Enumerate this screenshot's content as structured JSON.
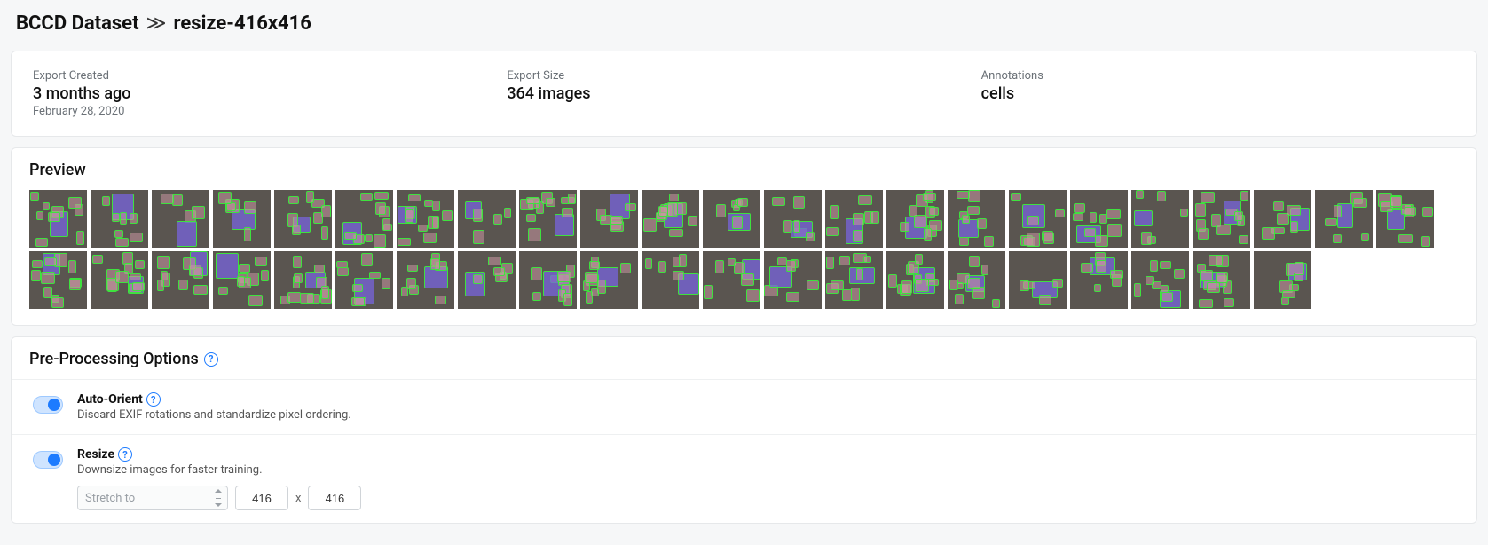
{
  "breadcrumb": {
    "dataset": "BCCD Dataset",
    "version": "resize-416x416"
  },
  "info": {
    "created_label": "Export Created",
    "created_value": "3 months ago",
    "created_date": "February 28, 2020",
    "size_label": "Export Size",
    "size_value": "364 images",
    "ann_label": "Annotations",
    "ann_value": "cells"
  },
  "preview": {
    "heading": "Preview",
    "thumb_count": 44
  },
  "preproc": {
    "heading": "Pre-Processing Options",
    "auto_orient": {
      "title": "Auto-Orient",
      "desc": "Discard EXIF rotations and standardize pixel ordering.",
      "enabled": true
    },
    "resize": {
      "title": "Resize",
      "desc": "Downsize images for faster training.",
      "enabled": true,
      "mode": "Stretch to",
      "width": "416",
      "height": "416",
      "sep": "x"
    }
  }
}
